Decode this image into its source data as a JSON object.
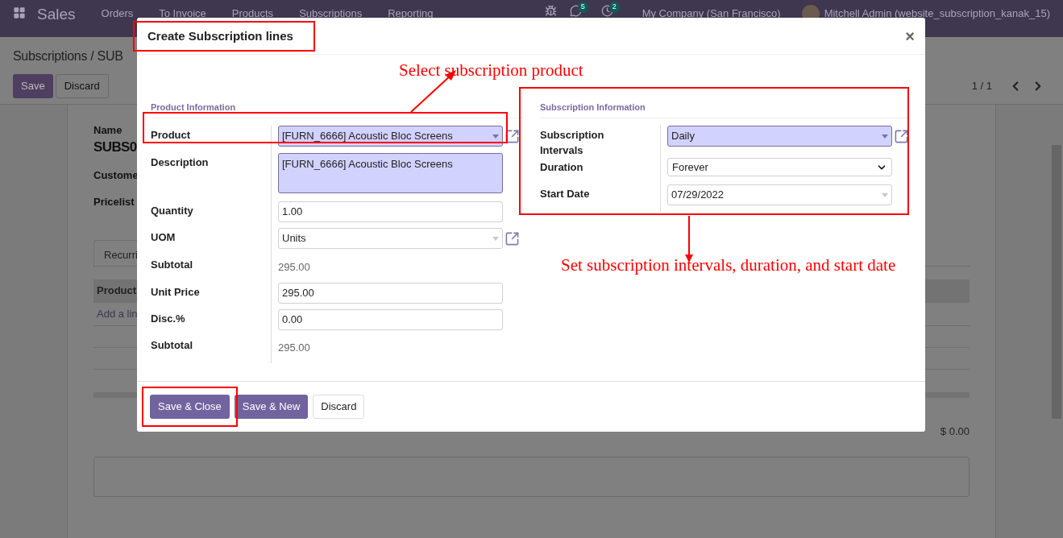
{
  "navbar": {
    "app": "Sales",
    "menu": [
      "Orders",
      "To Invoice",
      "Products",
      "Subscriptions",
      "Reporting"
    ],
    "chat_badge": "5",
    "activity_badge": "2",
    "company": "My Company (San Francisco)",
    "user": "Mitchell Admin (website_subscription_kanak_15)"
  },
  "control_panel": {
    "breadcrumb": "Subscriptions / SUB",
    "buttons": [
      {
        "label": "Save",
        "kind": "primary"
      },
      {
        "label": "Discard",
        "kind": "secondary"
      }
    ],
    "pager": "1 / 1"
  },
  "form": {
    "name_label": "Name",
    "name_value": "SUBS0",
    "fields": [
      "Custome",
      "Pricelist"
    ],
    "tab": "Recurri",
    "table_header": "Product",
    "add_line": "Add a lin",
    "total": "$ 0.00"
  },
  "dialog": {
    "title": "Create Subscription lines",
    "close": "×",
    "sections": [
      {
        "title": "Product Information",
        "fields": [
          {
            "label": "Product",
            "kind": "many2one",
            "value": "[FURN_6666] Acoustic Bloc Screens",
            "required": true,
            "external_link": true
          },
          {
            "label": "Description",
            "kind": "textarea",
            "value": "[FURN_6666] Acoustic Bloc Screens",
            "required": true
          },
          {
            "label": "Quantity",
            "kind": "input",
            "value": "1.00",
            "required": false
          },
          {
            "label": "UOM",
            "kind": "many2one",
            "value": "Units",
            "required": false,
            "external_link": true
          },
          {
            "label": "Subtotal",
            "kind": "readonly",
            "value": "295.00"
          },
          {
            "label": "Unit Price",
            "kind": "input",
            "value": "295.00",
            "required": false
          },
          {
            "label": "Disc.%",
            "kind": "input",
            "value": "0.00",
            "required": false
          },
          {
            "label": "Subtotal",
            "kind": "readonly",
            "value": "295.00"
          }
        ]
      },
      {
        "title": "Subscription Information",
        "fields": [
          {
            "label": "Subscription Intervals",
            "kind": "many2one",
            "value": "Daily",
            "required": true,
            "external_link": true
          },
          {
            "label": "Duration",
            "kind": "select",
            "value": "Forever",
            "required": false
          },
          {
            "label": "Start Date",
            "kind": "many2one",
            "value": "07/29/2022",
            "required": false,
            "external_link": false
          }
        ]
      }
    ],
    "buttons": [
      {
        "label": "Save & Close",
        "kind": "primary"
      },
      {
        "label": "Save & New",
        "kind": "primary"
      },
      {
        "label": "Discard",
        "kind": "secondary"
      }
    ]
  },
  "annotations": [
    {
      "text": "Select subscription product"
    },
    {
      "text": "Set subscription intervals, duration, and start date"
    }
  ]
}
